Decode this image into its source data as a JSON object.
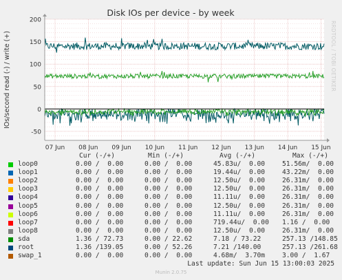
{
  "chart_data": {
    "type": "line",
    "title": "Disk IOs per device - by week",
    "ylabel": "IOs/second read (-) / write (+)",
    "ylim": [
      -70,
      200
    ],
    "yticks": [
      -50,
      0,
      50,
      100,
      150,
      200
    ],
    "x_ticks": [
      "07 Jun",
      "08 Jun",
      "09 Jun",
      "10 Jun",
      "11 Jun",
      "12 Jun",
      "13 Jun",
      "14 Jun",
      "15 Jun"
    ],
    "grid": true,
    "series": [
      {
        "name": "root",
        "color": "#005a63",
        "write_level": 140,
        "write_jitter": 8,
        "read_level": -20,
        "read_jitter": 18
      },
      {
        "name": "sda",
        "color": "#2ba02b",
        "write_level": 73,
        "write_jitter": 5,
        "read_level": -7,
        "read_jitter": 10
      }
    ]
  },
  "side_label": "RRDTOOL / TOBI OETIKER",
  "legend_header": {
    "cur": "Cur (-/+)",
    "min": "Min (-/+)",
    "avg": "Avg (-/+)",
    "max": "Max (-/+)"
  },
  "legend": [
    {
      "name": "loop0",
      "color": "#00cc00",
      "cur": "0.00 /  0.00",
      "min": "0.00 /  0.00",
      "avg": "45.83u/  0.00",
      "max": "51.56m/  0.00"
    },
    {
      "name": "loop1",
      "color": "#0066b3",
      "cur": "0.00 /  0.00",
      "min": "0.00 /  0.00",
      "avg": "19.44u/  0.00",
      "max": "43.22m/  0.00"
    },
    {
      "name": "loop2",
      "color": "#ff8000",
      "cur": "0.00 /  0.00",
      "min": "0.00 /  0.00",
      "avg": "12.50u/  0.00",
      "max": "26.31m/  0.00"
    },
    {
      "name": "loop3",
      "color": "#ffcc00",
      "cur": "0.00 /  0.00",
      "min": "0.00 /  0.00",
      "avg": "12.50u/  0.00",
      "max": "26.31m/  0.00"
    },
    {
      "name": "loop4",
      "color": "#330099",
      "cur": "0.00 /  0.00",
      "min": "0.00 /  0.00",
      "avg": "11.11u/  0.00",
      "max": "26.31m/  0.00"
    },
    {
      "name": "loop5",
      "color": "#990099",
      "cur": "0.00 /  0.00",
      "min": "0.00 /  0.00",
      "avg": "12.50u/  0.00",
      "max": "26.31m/  0.00"
    },
    {
      "name": "loop6",
      "color": "#ccff00",
      "cur": "0.00 /  0.00",
      "min": "0.00 /  0.00",
      "avg": "11.11u/  0.00",
      "max": "26.31m/  0.00"
    },
    {
      "name": "loop7",
      "color": "#ff0000",
      "cur": "0.00 /  0.00",
      "min": "0.00 /  0.00",
      "avg": "719.44u/  0.00",
      "max": "1.16 /  0.00"
    },
    {
      "name": "loop8",
      "color": "#808080",
      "cur": "0.00 /  0.00",
      "min": "0.00 /  0.00",
      "avg": "12.50u/  0.00",
      "max": "26.31m/  0.00"
    },
    {
      "name": "sda",
      "color": "#008f00",
      "cur": "1.36 / 72.73",
      "min": "0.00 / 22.62",
      "avg": "7.18 / 73.22",
      "max": "257.13 /148.85"
    },
    {
      "name": "root",
      "color": "#00487d",
      "cur": "1.36 /139.05",
      "min": "0.00 / 52.26",
      "avg": "7.21 /140.00",
      "max": "257.13 /261.68"
    },
    {
      "name": "swap_1",
      "color": "#b35a00",
      "cur": "0.00 /  0.00",
      "min": "0.00 /  0.00",
      "avg": "4.68m/  3.70m",
      "max": "3.00 /  1.67"
    }
  ],
  "last_update": "Last update: Sun Jun 15 13:00:03 2025",
  "footer": "Munin 2.0.75"
}
